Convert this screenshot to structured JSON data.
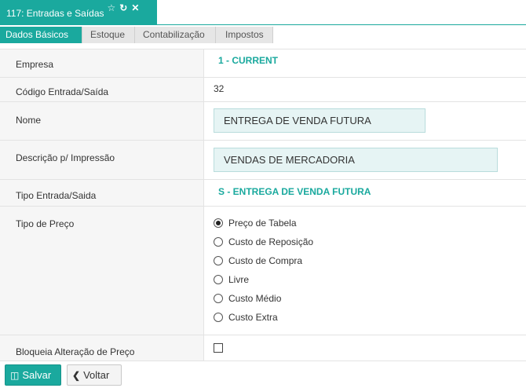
{
  "window": {
    "title": "117: Entradas e Saídas",
    "star_icon": "☆",
    "refresh_icon": "↻",
    "close_icon": "✕"
  },
  "tabs": [
    {
      "label": "Dados Básicos",
      "active": true
    },
    {
      "label": "Estoque"
    },
    {
      "label": "Contabilização"
    },
    {
      "label": "Impostos"
    }
  ],
  "form": {
    "empresa": {
      "label": "Empresa",
      "value": "1 - CURRENT"
    },
    "codigo": {
      "label": "Código Entrada/Saída",
      "value": "32"
    },
    "nome": {
      "label": "Nome",
      "value": "ENTREGA DE VENDA FUTURA"
    },
    "descricao": {
      "label": "Descrição p/ Impressão",
      "value": "VENDAS DE MERCADORIA"
    },
    "tipo_entrada": {
      "label": "Tipo Entrada/Saida",
      "value": "S - ENTREGA DE VENDA FUTURA"
    },
    "tipo_preco": {
      "label": "Tipo de Preço",
      "options": [
        "Preço de Tabela",
        "Custo de Reposição",
        "Custo de Compra",
        "Livre",
        "Custo Médio",
        "Custo Extra"
      ],
      "selected": "Preço de Tabela"
    },
    "bloqueia": {
      "label": "Bloqueia Alteração de Preço",
      "checked": false
    }
  },
  "footer": {
    "save_label": "Salvar",
    "back_label": "Voltar",
    "save_icon": "💾",
    "back_icon": "❮"
  },
  "colors": {
    "accent": "#1aa99e",
    "field_bg": "#e6f4f4"
  }
}
